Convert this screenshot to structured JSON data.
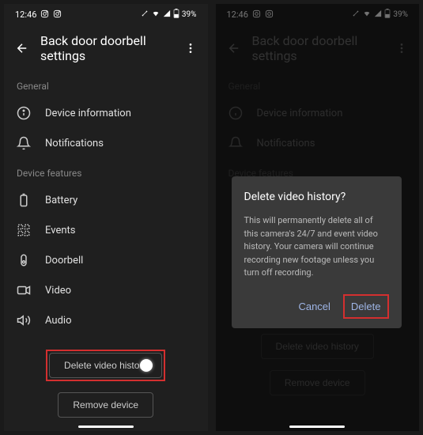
{
  "status": {
    "time": "12:46",
    "battery": "39%"
  },
  "header": {
    "title": "Back door doorbell settings"
  },
  "sections": {
    "general": "General",
    "device_features": "Device features"
  },
  "items": {
    "device_info": "Device information",
    "notifications": "Notifications",
    "battery": "Battery",
    "events": "Events",
    "doorbell": "Doorbell",
    "video": "Video",
    "audio": "Audio"
  },
  "buttons": {
    "delete_history": "Delete video history",
    "remove_device": "Remove device"
  },
  "modal": {
    "title": "Delete video history?",
    "body": "This will permanently delete all of this camera's 24/7 and event video history. Your camera will continue recording new footage unless you turn off recording.",
    "cancel": "Cancel",
    "delete": "Delete"
  }
}
